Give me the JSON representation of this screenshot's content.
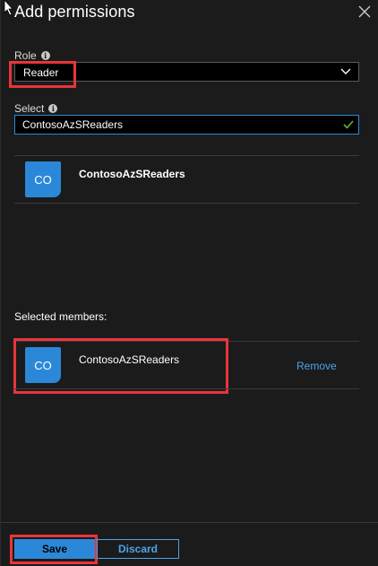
{
  "panel": {
    "title": "Add permissions",
    "close_icon": "close-icon"
  },
  "role": {
    "label": "Role",
    "selected": "Reader"
  },
  "select": {
    "label": "Select",
    "value": "ContosoAzSReaders"
  },
  "search_results": [
    {
      "avatar": "CO",
      "name": "ContosoAzSReaders"
    }
  ],
  "selected_members": {
    "label": "Selected members:",
    "items": [
      {
        "avatar": "CO",
        "name": "ContosoAzSReaders",
        "action": "Remove"
      }
    ]
  },
  "footer": {
    "save_label": "Save",
    "discard_label": "Discard"
  },
  "colors": {
    "background": "#1b1b1b",
    "accent": "#2b88d8",
    "link": "#4aa3ea",
    "highlight": "#e8353a",
    "valid": "#5fb832"
  }
}
